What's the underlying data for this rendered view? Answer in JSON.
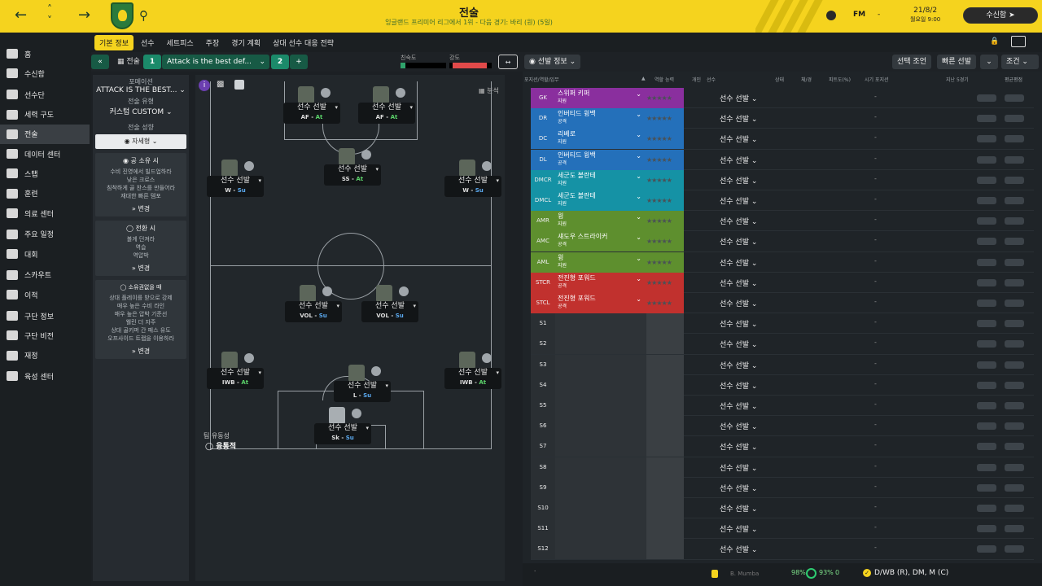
{
  "topbar": {
    "title": "전술",
    "subtitle": "잉글랜드 프리미어 리그에서 1위 - 다음 경기: 바리 (원) (5일)",
    "date": "21/8/2",
    "time": "월요일 9:00",
    "inbox": "수신함",
    "fm": "FM",
    "dash": "-"
  },
  "sidebar": {
    "items": [
      {
        "label": "홈",
        "icon": "home-icon"
      },
      {
        "label": "수신함",
        "icon": "inbox-icon"
      },
      {
        "label": "선수단",
        "icon": "squad-icon"
      },
      {
        "label": "세력 구도",
        "icon": "dynamics-icon"
      },
      {
        "label": "전술",
        "icon": "tactics-icon",
        "active": true
      },
      {
        "label": "데이터 센터",
        "icon": "data-icon"
      },
      {
        "label": "스탭",
        "icon": "staff-icon"
      },
      {
        "label": "훈련",
        "icon": "training-icon"
      },
      {
        "label": "의료 센터",
        "icon": "medical-icon"
      },
      {
        "label": "주요 일정",
        "icon": "calendar-icon"
      },
      {
        "label": "대회",
        "icon": "trophy-icon"
      },
      {
        "label": "스카우트",
        "icon": "scout-icon"
      },
      {
        "label": "이적",
        "icon": "transfer-icon"
      },
      {
        "label": "구단 정보",
        "icon": "club-icon"
      },
      {
        "label": "구단 비전",
        "icon": "vision-icon"
      },
      {
        "label": "재정",
        "icon": "finance-icon"
      },
      {
        "label": "육성 센터",
        "icon": "development-icon"
      }
    ]
  },
  "subnav": {
    "tabs": [
      "기본 정보",
      "선수",
      "세트피스",
      "주장",
      "경기 계획",
      "상대 선수 대응 전략"
    ]
  },
  "toolrow": {
    "tactic_label": "전술",
    "slot1": "1",
    "tactic_name": "Attack is the best def...",
    "slot2": "2",
    "plus": "+",
    "fluency_label": "친숙도",
    "intensity_label": "강도",
    "player_info": "선발 정보",
    "select_cond": "선택 조언",
    "quick_select": "빠른 선발",
    "conditions": "조건"
  },
  "leftpanel": {
    "formation_label": "포메이션",
    "formation_value": "ATTACK IS THE BEST...",
    "style_label": "전술 유형",
    "style_value": "커스텀 CUSTOM",
    "mentality_label": "전술 성향",
    "mentality_value": "자세형",
    "in_possession": {
      "title": "공 소유 시",
      "lines": [
        "수비 진영에서 빌드업하라",
        "낮은 크로스",
        "침착하게 골 찬스를 만들어라",
        "재대한 빠른 템포"
      ],
      "change": "변경"
    },
    "transition": {
      "title": "전환 시",
      "lines": [
        "볼게 던져라",
        "역습",
        "역압박"
      ],
      "change": "변경"
    },
    "out_possession": {
      "title": "소유권없을 때",
      "lines": [
        "상대 플레이를 받으로 강제",
        "매우 높은 수비 라인",
        "매우 높은 압박 기준선",
        "웰린 더 자주",
        "상대 골키퍼 간 패스 유도",
        "오프사이드 트랩을 이용하라"
      ],
      "change": "변경"
    }
  },
  "pitch": {
    "analysis": "분석",
    "team_fluency_label": "팀 유동성",
    "team_fluency_value": "융통적",
    "players": [
      {
        "name": "선수 선발",
        "role": "AF",
        "duty": "At"
      },
      {
        "name": "선수 선발",
        "role": "AF",
        "duty": "At"
      },
      {
        "name": "선수 선발",
        "role": "W",
        "duty": "Su"
      },
      {
        "name": "선수 선발",
        "role": "SS",
        "duty": "At"
      },
      {
        "name": "선수 선발",
        "role": "W",
        "duty": "Su"
      },
      {
        "name": "선수 선발",
        "role": "VOL",
        "duty": "Su"
      },
      {
        "name": "선수 선발",
        "role": "VOL",
        "duty": "Su"
      },
      {
        "name": "선수 선발",
        "role": "IWB",
        "duty": "At"
      },
      {
        "name": "선수 선발",
        "role": "L",
        "duty": "Su"
      },
      {
        "name": "선수 선발",
        "role": "IWB",
        "duty": "At"
      },
      {
        "name": "선수 선발",
        "role": "Sk",
        "duty": "Su"
      }
    ]
  },
  "right": {
    "headers": {
      "pos": "포지션/역할/임무",
      "ability": "역할 능력",
      "ind": "개인",
      "player": "선수",
      "cond": "상태",
      "sharp": "체/경",
      "fit": "피트도(%)",
      "time": "시기 포지션",
      "last5": "지난 5경기",
      "avg": "평균평점"
    },
    "rows": [
      {
        "pos": "GK",
        "role": "스위퍼 키퍼",
        "duty": "지원",
        "color": "#8a2f9e"
      },
      {
        "pos": "DR",
        "role": "인버티드 윙백",
        "duty": "공격",
        "color": "#2470ba"
      },
      {
        "pos": "DC",
        "role": "리베로",
        "duty": "지원",
        "color": "#2470ba"
      },
      {
        "pos": "DL",
        "role": "인버티드 윙백",
        "duty": "공격",
        "color": "#2470ba"
      },
      {
        "pos": "DMCR",
        "role": "세군도 볼란테",
        "duty": "지원",
        "color": "#1592a5"
      },
      {
        "pos": "DMCL",
        "role": "세군도 볼란테",
        "duty": "지원",
        "color": "#1592a5"
      },
      {
        "pos": "AMR",
        "role": "윙",
        "duty": "지원",
        "color": "#5e8f2e"
      },
      {
        "pos": "AMC",
        "role": "섀도우 스트라이커",
        "duty": "공격",
        "color": "#5e8f2e"
      },
      {
        "pos": "AML",
        "role": "윙",
        "duty": "지원",
        "color": "#5e8f2e"
      },
      {
        "pos": "STCR",
        "role": "전진형 포워드",
        "duty": "공격",
        "color": "#c1312e"
      },
      {
        "pos": "STCL",
        "role": "전진형 포워드",
        "duty": "공격",
        "color": "#c1312e"
      },
      {
        "pos": "S1"
      },
      {
        "pos": "S2"
      },
      {
        "pos": "S3"
      },
      {
        "pos": "S4"
      },
      {
        "pos": "S5"
      },
      {
        "pos": "S6"
      },
      {
        "pos": "S7"
      },
      {
        "pos": "S8"
      },
      {
        "pos": "S9"
      },
      {
        "pos": "S10"
      },
      {
        "pos": "S11"
      },
      {
        "pos": "S12"
      }
    ],
    "select": "선수 선발",
    "dash": "-"
  },
  "bottombar": {
    "name": "B. Mumba",
    "fit1": "98%",
    "fit2": "93%",
    "zero": "0",
    "positions": "D/WB (R), DM, M (C)"
  }
}
